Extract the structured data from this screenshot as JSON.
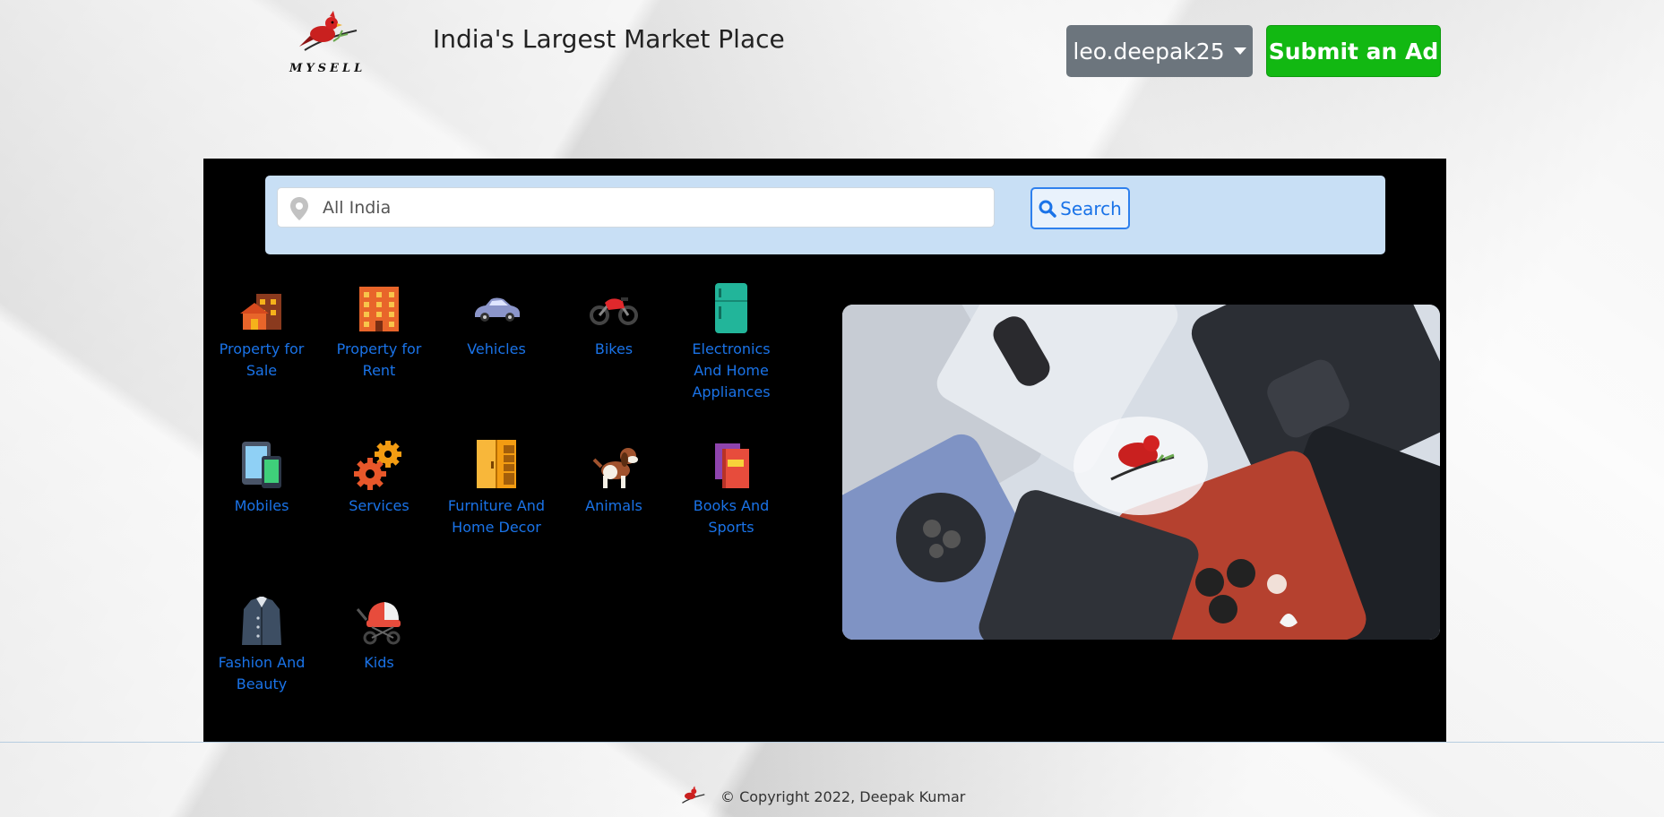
{
  "header": {
    "logo_text": "MYSELL",
    "tagline": "India's Largest Market Place",
    "user_menu_label": "leo.deepak25",
    "submit_ad_label": "Submit an Ad"
  },
  "search": {
    "location_value": "All India",
    "search_label": "Search"
  },
  "categories": [
    {
      "label": "Property for Sale",
      "icon": "house-icon"
    },
    {
      "label": "Property for Rent",
      "icon": "building-icon"
    },
    {
      "label": "Vehicles",
      "icon": "car-icon"
    },
    {
      "label": "Bikes",
      "icon": "motorbike-icon"
    },
    {
      "label": "Electronics And Home Appliances",
      "icon": "fridge-icon"
    },
    {
      "label": "Mobiles",
      "icon": "tablet-phone-icon"
    },
    {
      "label": "Services",
      "icon": "gears-icon"
    },
    {
      "label": "Furniture And Home Decor",
      "icon": "wardrobe-icon"
    },
    {
      "label": "Animals",
      "icon": "dog-icon"
    },
    {
      "label": "Books And Sports",
      "icon": "books-icon"
    },
    {
      "label": "Fashion And Beauty",
      "icon": "coat-icon"
    },
    {
      "label": "Kids",
      "icon": "stroller-icon"
    }
  ],
  "footer": {
    "copyright": "© Copyright 2022, Deepak Kumar"
  },
  "colors": {
    "accent_blue": "#1a73e8",
    "submit_green": "#12b812",
    "user_gray": "#6c757d"
  }
}
